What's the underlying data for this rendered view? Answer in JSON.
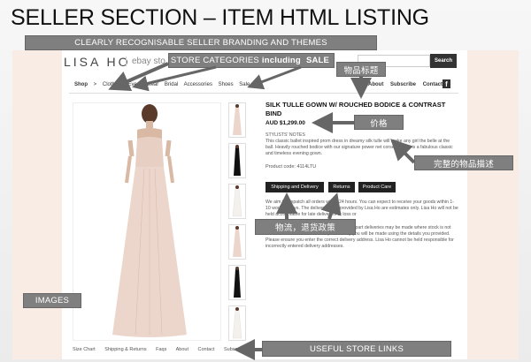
{
  "slide_title": "SELLER SECTION – ITEM HTML LISTING",
  "store": {
    "logo": "LISA HO",
    "ebay_text": "ebay sto",
    "search_label": "Search"
  },
  "nav": {
    "left": [
      "Shop",
      ">",
      "Clothing",
      "Eveningwear",
      "Bridal",
      "Accessories",
      "Shoes",
      "Sale"
    ],
    "right": [
      "About",
      "Subscribe",
      "Contact"
    ],
    "fb": "f"
  },
  "product": {
    "title": "SILK TULLE GOWN W/ ROUCHED BODICE & CONTRAST BIND",
    "price": "AUD $1,299.00",
    "notes_heading": "STYLISTS' NOTES",
    "description": "This classic ballet inspired prom dress in dreamy silk tulle will make any girl the belle at the ball. Heavily rouched bodice with our signature power net corset inner it is a fabulous classic and timeless evening gown.",
    "product_code": "Product code: 4114LTU"
  },
  "tabs": [
    "Shipping and Delivery",
    "Returns",
    "Product Care"
  ],
  "shipping_text_top": "We aim to dispatch all orders within 24 hours. You can expect to receive your goods within 1-10 working days. The delivery times provided by Lisa Ho are estimates only. Lisa Ho will not be held accountable for late deliveries or loss or",
  "shipping_text_bottom": "In the event that multiple items are ordered, part deliveries may be made where stock is not available. All reasonable attempts to notify you will be made using the details you provided. Please ensure you enter the correct delivery address. Lisa Ho cannot be held responsible for incorrectly entered delivery addresses.",
  "footer_links": [
    "Size Chart",
    "Shipping & Returns",
    "Faqs",
    "About",
    "Contact",
    "Subscribe"
  ],
  "annotations": {
    "branding": "CLEARLY RECOGNISABLE SELLER BRANDING AND THEMES",
    "categories_pre": "STORE CATEGORIES",
    "categories_bold1": "including",
    "categories_bold2": "SALE",
    "item_title": "物品标题",
    "price": "价格",
    "description": "完整的物品描述",
    "shipping": "物流，退货政策",
    "images": "IMAGES",
    "links": "USEFUL STORE LINKS"
  },
  "colors": {
    "annotation_bg": "#7f7f7f",
    "page_tint": "#f9ece4",
    "button_dark": "#222222",
    "dress": "#e8cfc4"
  }
}
